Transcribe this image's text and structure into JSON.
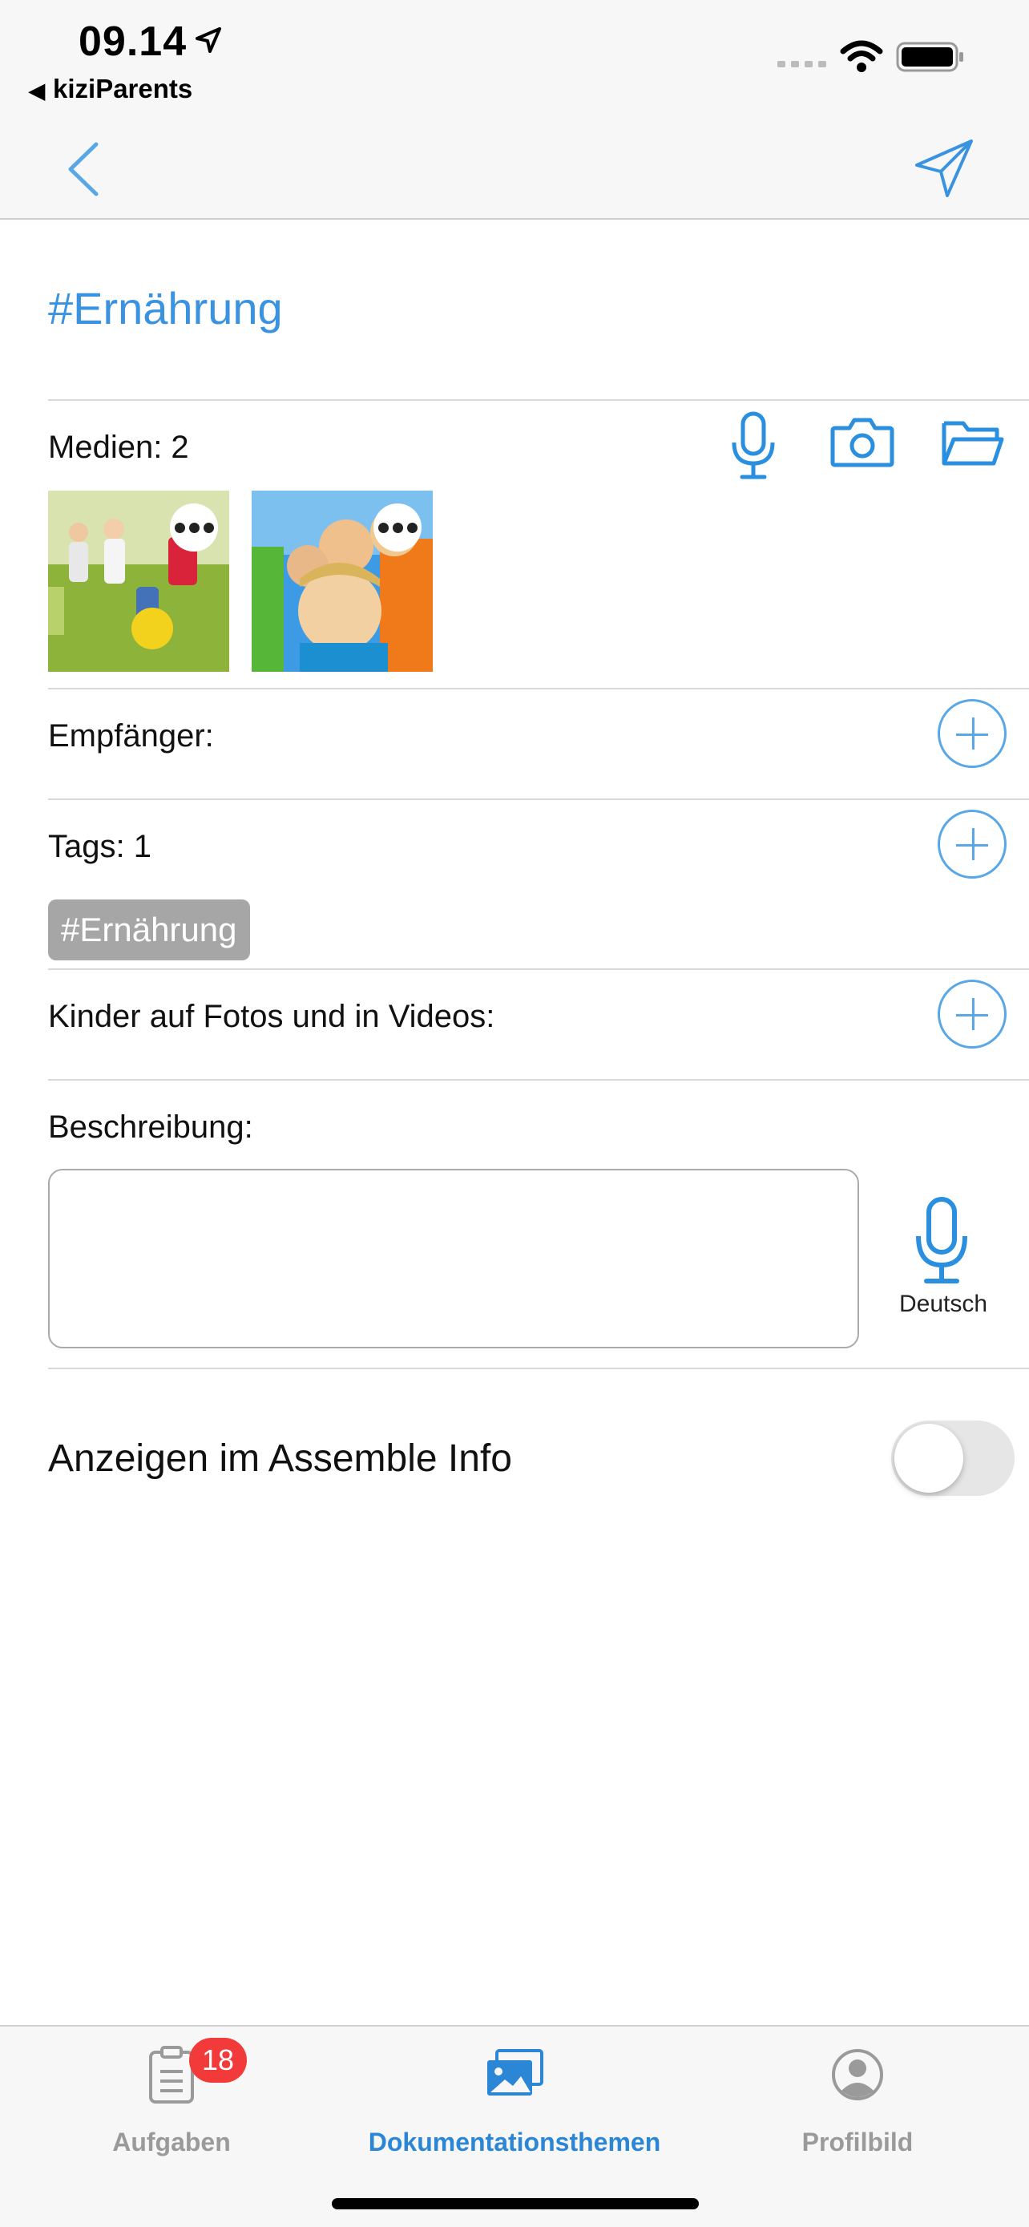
{
  "status_bar": {
    "time": "09.14",
    "back_app_label": "kiziParents"
  },
  "page": {
    "title": "#Ernährung"
  },
  "media": {
    "label": "Medien: 2",
    "icons": [
      "microphone-icon",
      "camera-icon",
      "folder-icon"
    ]
  },
  "recipients": {
    "label": "Empfänger:"
  },
  "tags": {
    "label": "Tags: 1",
    "items": [
      "#Ernährung"
    ]
  },
  "children": {
    "label": "Kinder auf Fotos und in Videos:"
  },
  "description": {
    "label": "Beschreibung:",
    "value": "",
    "language": "Deutsch"
  },
  "assemble": {
    "label": "Anzeigen im Assemble Info",
    "enabled": false
  },
  "tab_bar": {
    "tabs": [
      {
        "label": "Aufgaben",
        "badge": "18",
        "icon": "clipboard-icon",
        "active": false
      },
      {
        "label": "Dokumentationsthemen",
        "icon": "photos-icon",
        "active": true
      },
      {
        "label": "Profilbild",
        "icon": "profile-icon",
        "active": false
      }
    ]
  },
  "colors": {
    "accent": "#3a93e0",
    "badge": "#f23a3a",
    "tag_chip": "#a6a6a6"
  }
}
